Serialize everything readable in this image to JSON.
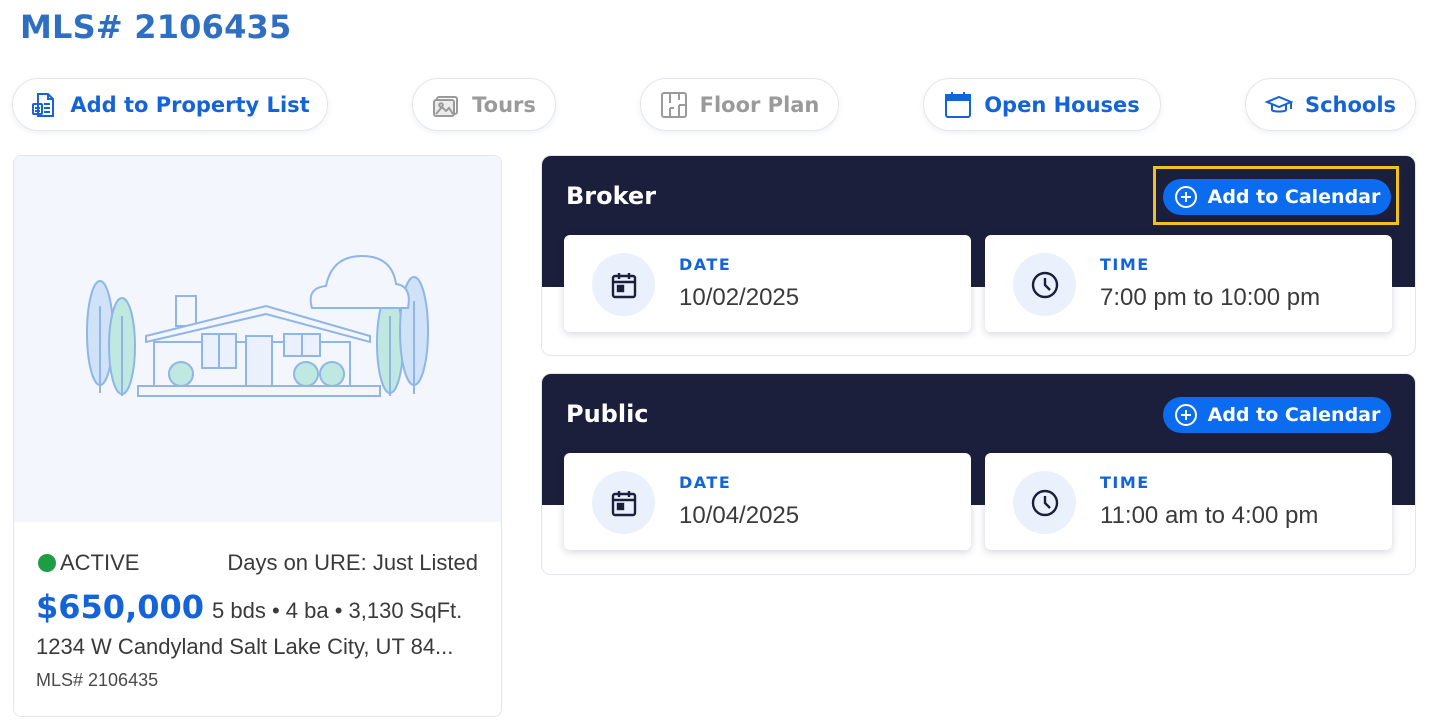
{
  "page": {
    "title": "MLS# 2106435"
  },
  "actions": [
    {
      "label": "Add to Property List",
      "icon": "property-list-icon",
      "state": "enabled"
    },
    {
      "label": "Tours",
      "icon": "image-icon",
      "state": "disabled"
    },
    {
      "label": "Floor Plan",
      "icon": "floor-plan-icon",
      "state": "disabled"
    },
    {
      "label": "Open Houses",
      "icon": "calendar-icon",
      "state": "enabled"
    },
    {
      "label": "Schools",
      "icon": "graduation-cap-icon",
      "state": "enabled"
    }
  ],
  "property": {
    "status": "ACTIVE",
    "days_on": "Days on URE: Just Listed",
    "price": "$650,000",
    "specs": "5 bds • 4 ba • 3,130 SqFt.",
    "address": "1234 W Candyland Salt Lake City, UT 84...",
    "mls": "MLS# 2106435"
  },
  "open_houses": {
    "broker": {
      "title": "Broker",
      "button": "Add to Calendar",
      "date_label": "DATE",
      "date": "10/02/2025",
      "time_label": "TIME",
      "time": "7:00 pm to 10:00 pm"
    },
    "public": {
      "title": "Public",
      "button": "Add to Calendar",
      "date_label": "DATE",
      "date": "10/04/2025",
      "time_label": "TIME",
      "time": "11:00 am to 4:00 pm"
    }
  },
  "colors": {
    "accent": "#1464d8",
    "title": "#2f6fc2",
    "panel_dark": "#1b1f3b",
    "button_blue": "#0b6cf0",
    "status_green": "#1f9d46",
    "highlight": "#f3c11b"
  }
}
